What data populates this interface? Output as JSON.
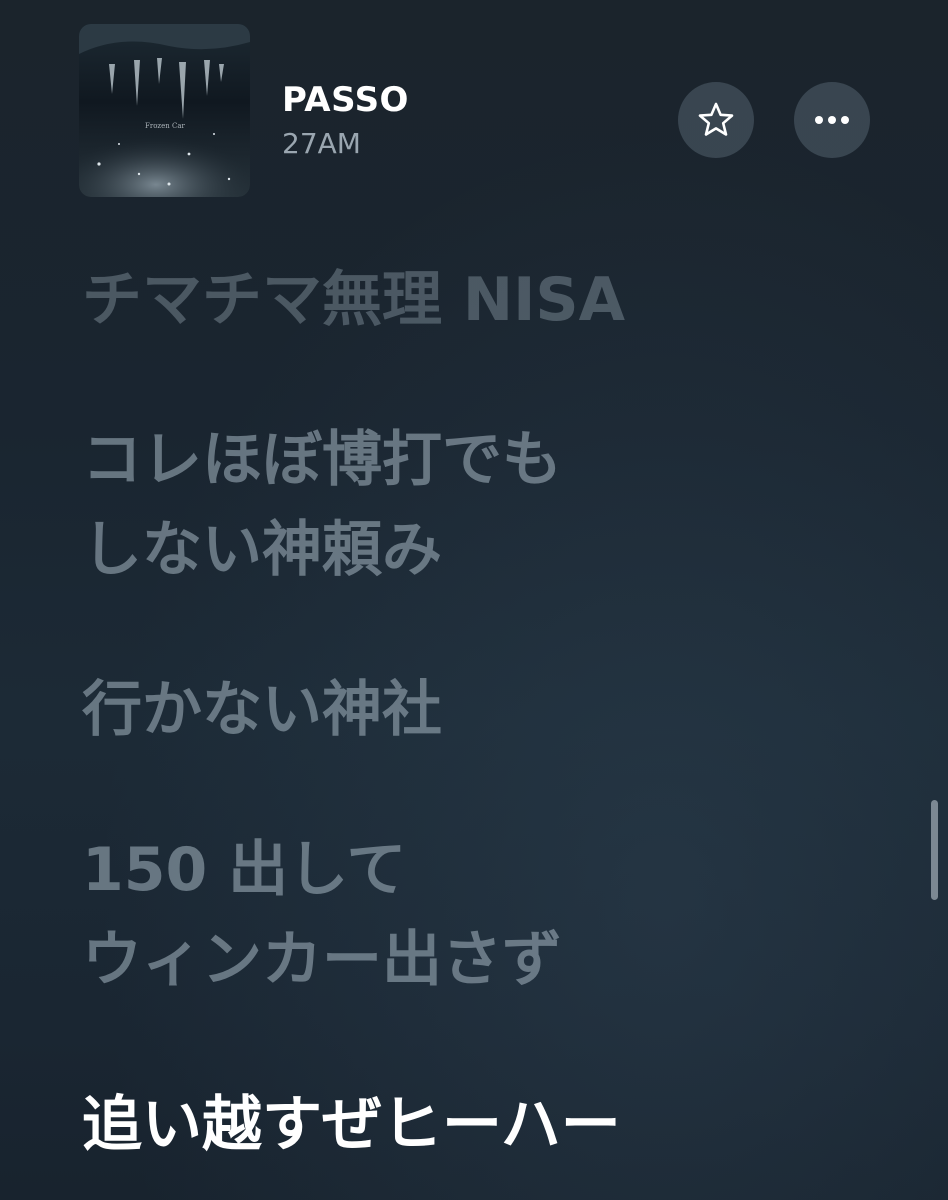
{
  "header": {
    "track_title": "PASSO",
    "artist": "27AM",
    "artwork_icon": "album-artwork-icon",
    "artwork_text": "Frozen Car",
    "star_icon": "star-icon",
    "more_icon": "ellipsis-icon"
  },
  "lyrics": {
    "lines": [
      {
        "text": "チマチマ無理 NISA",
        "state": "past"
      },
      {
        "text": "コレほぼ博打でも",
        "state": "past"
      },
      {
        "text": "しない神頼み",
        "state": "past"
      },
      {
        "text": "行かない神社",
        "state": "past"
      },
      {
        "text": "150 出して",
        "state": "past"
      },
      {
        "text": "ウィンカー出さず",
        "state": "past"
      },
      {
        "text": "追い越すぜヒーハー",
        "state": "current"
      }
    ]
  },
  "colors": {
    "background": "#1b2530",
    "active_lyric": "#ffffff",
    "inactive_lyric": "#96a6b2",
    "artist": "#9aa6b0",
    "button_bg": "#4a5a66"
  }
}
